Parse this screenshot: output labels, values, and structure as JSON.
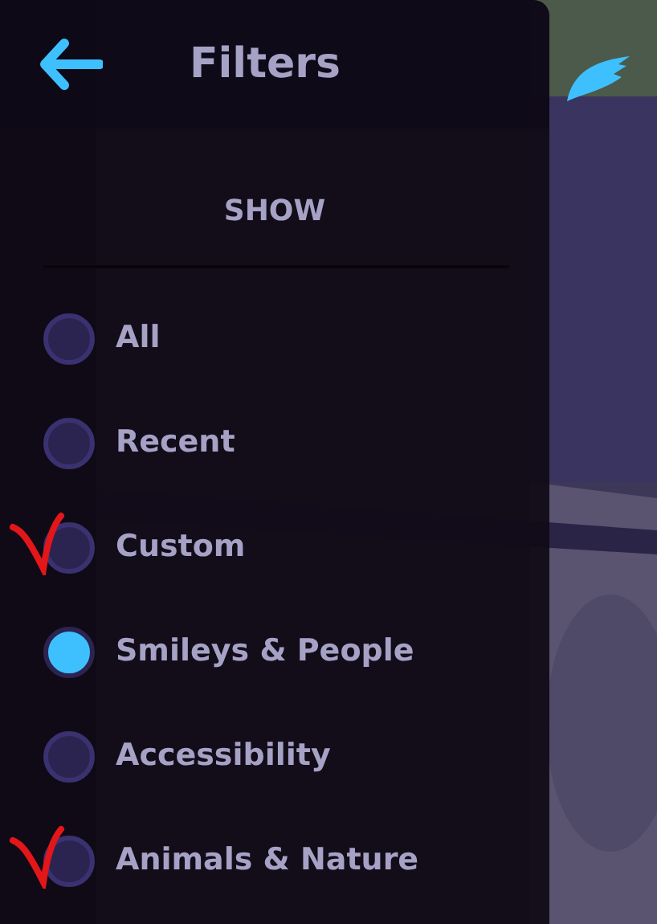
{
  "header": {
    "title": "Filters"
  },
  "section": {
    "title": "SHOW"
  },
  "options": [
    {
      "label": "All",
      "selected": false,
      "marked": false
    },
    {
      "label": "Recent",
      "selected": false,
      "marked": false
    },
    {
      "label": "Custom",
      "selected": false,
      "marked": true
    },
    {
      "label": "Smileys & People",
      "selected": true,
      "marked": false
    },
    {
      "label": "Accessibility",
      "selected": false,
      "marked": false
    },
    {
      "label": "Animals & Nature",
      "selected": false,
      "marked": true
    }
  ]
}
